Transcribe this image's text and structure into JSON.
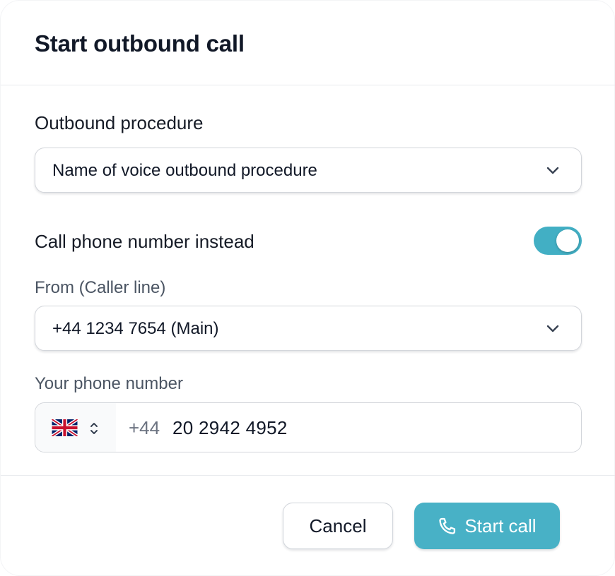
{
  "dialog": {
    "title": "Start outbound call"
  },
  "procedure": {
    "label": "Outbound procedure",
    "selected": "Name of voice outbound procedure",
    "icon": "chevron-down-icon"
  },
  "toggle": {
    "label": "Call phone number instead",
    "on": true,
    "color": "#42afc4"
  },
  "caller_line": {
    "label": "From (Caller line)",
    "selected": "+44 1234 7654 (Main)",
    "icon": "chevron-down-icon"
  },
  "your_number": {
    "label": "Your phone number",
    "country_icon": "uk-flag-icon",
    "country_selector_icon": "chevron-up-down-icon",
    "prefix": "+44",
    "value": "20 2942 4952"
  },
  "actions": {
    "cancel_label": "Cancel",
    "start_label": "Start call",
    "start_icon": "phone-icon",
    "accent": "#48b1c6"
  }
}
